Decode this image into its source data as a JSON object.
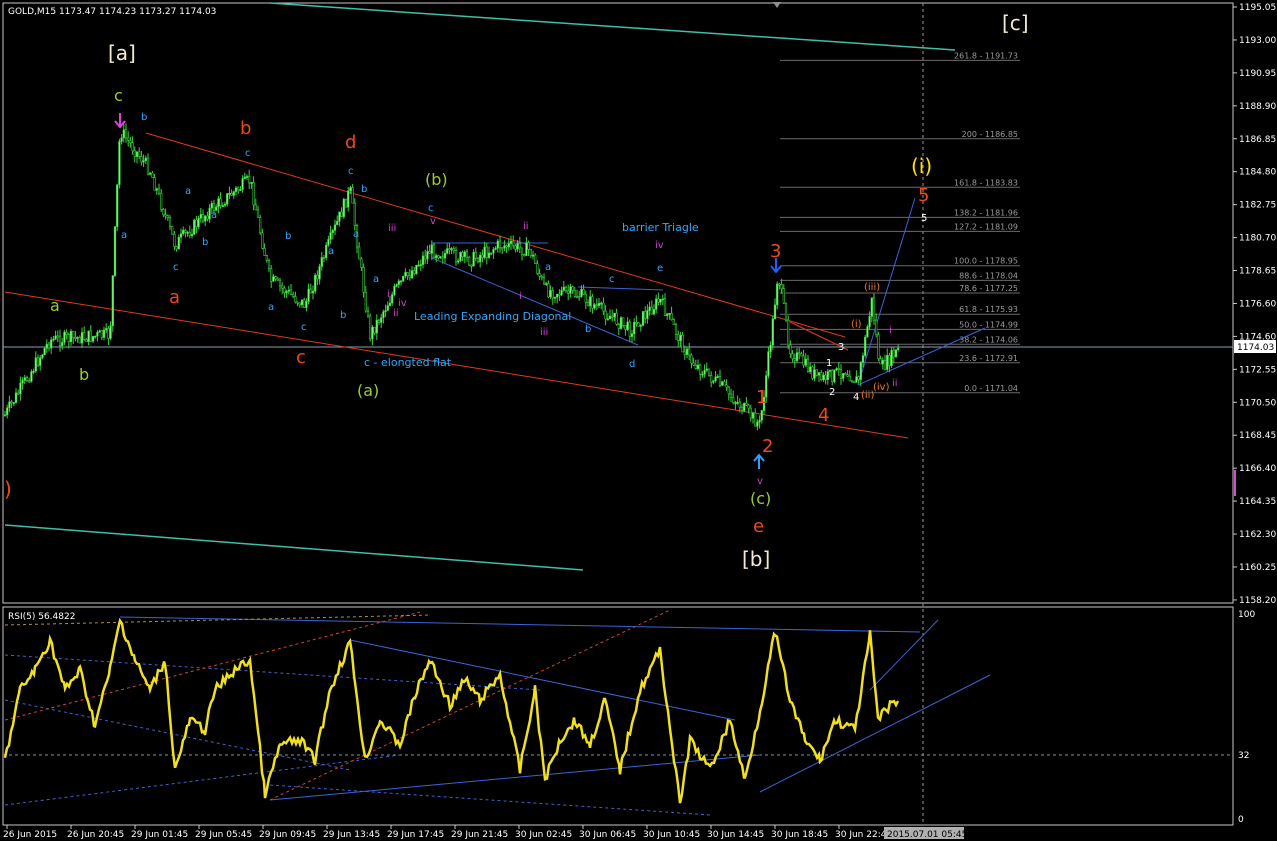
{
  "window": {
    "symbol_header": "GOLD,M15  1173.47 1174.23 1173.27 1174.03",
    "current_price": "1174.03",
    "last_time_label": "2015.07.01 05:45"
  },
  "price_axis": {
    "ticks": [
      "1195.05",
      "1193.00",
      "1190.95",
      "1188.90",
      "1186.85",
      "1184.80",
      "1182.75",
      "1180.70",
      "1178.65",
      "1176.60",
      "1174.60",
      "1172.55",
      "1170.50",
      "1168.45",
      "1166.40",
      "1164.35",
      "1162.30",
      "1160.25",
      "1158.20"
    ]
  },
  "rsi": {
    "label": "RSI(5) 56.4822",
    "levels": [
      "100",
      "32",
      "0"
    ]
  },
  "time_axis": {
    "labels": [
      "26 Jun 2015",
      "26 Jun 20:45",
      "29 Jun 01:45",
      "29 Jun 05:45",
      "29 Jun 09:45",
      "29 Jun 13:45",
      "29 Jun 17:45",
      "29 Jun 21:45",
      "30 Jun 02:45",
      "30 Jun 06:45",
      "30 Jun 10:45",
      "30 Jun 14:45",
      "30 Jun 18:45",
      "30 Jun 22:45"
    ]
  },
  "fib_levels": [
    {
      "label": "261.8 - 1191.73",
      "price": 1191.73
    },
    {
      "label": "200 - 1186.85",
      "price": 1186.85
    },
    {
      "label": "161.8 - 1183.83",
      "price": 1183.83
    },
    {
      "label": "138.2 - 1181.96",
      "price": 1181.96
    },
    {
      "label": "127.2 - 1181.09",
      "price": 1181.09
    },
    {
      "label": "100.0 - 1178.95",
      "price": 1178.95
    },
    {
      "label": "88.6 - 1178.04",
      "price": 1178.04
    },
    {
      "label": "78.6 - 1177.25",
      "price": 1177.25
    },
    {
      "label": "61.8 - 1175.93",
      "price": 1175.93
    },
    {
      "label": "50.0 - 1174.99",
      "price": 1174.99
    },
    {
      "label": "38.2 - 1174.06",
      "price": 1174.06
    },
    {
      "label": "23.6 - 1172.91",
      "price": 1172.91
    },
    {
      "label": "0.0 - 1171.04",
      "price": 1171.04
    }
  ],
  "annotations": {
    "a_bracket": "[a]",
    "b_bracket": "[b]",
    "c_bracket": "[c]",
    "wave_c_top": "c",
    "wave_b_red": "b",
    "wave_d_red": "d",
    "wave_a_red": "a",
    "wave_c_red": "c",
    "wave_b_green": "(b)",
    "wave_a_green": "(a)",
    "wave_c_green": "(c)",
    "wave_e_red": "e",
    "wave_3_red": "3",
    "wave_2_red": "2",
    "wave_1_red": "1",
    "wave_4_red": "4",
    "wave_5_red": "5",
    "wave_i_yellow": "(i)",
    "wave_a_left": "a",
    "wave_b_left": "b",
    "paren_left": ")",
    "leading_diagonal": "Leading Expanding Diagonal",
    "barrier_triangle": "barrier Triagle",
    "elongated_flat": "c - elongted flat",
    "small_b1": "b",
    "small_a1": "a",
    "small_c1": "c",
    "small_b2": "b",
    "small_a2": "a",
    "small_c3": "c",
    "small_b3": "b",
    "small_a3": "a",
    "small_c4": "c",
    "small_a4": "a",
    "small_b4": "b",
    "small_c5": "c",
    "small_b5": "b",
    "small_a5": "a",
    "small_c6": "c",
    "small_b6": "b",
    "small_c7": "c",
    "small_v7": "v",
    "small_iv1": "iv",
    "small_ii1": "ii",
    "small_iii1": "iii",
    "small_i1": "i",
    "small_ii2": "ii",
    "small_iii2": "iii",
    "small_i2": "i",
    "small_a8": "a",
    "small_b8": "b",
    "small_c8": "c",
    "small_d8": "d",
    "small_e8": "e",
    "small_iv2": "iv",
    "small_v_bottom": "v",
    "w1_white": "1",
    "w2_white": "2",
    "w3_white": "3",
    "w4_white": "4",
    "w5_white": "5",
    "o_i": "(i)",
    "o_ii": "(ii)",
    "o_iii": "(iii)",
    "o_iv": "(iv)",
    "m_i": "i",
    "m_ii": "ii"
  }
}
